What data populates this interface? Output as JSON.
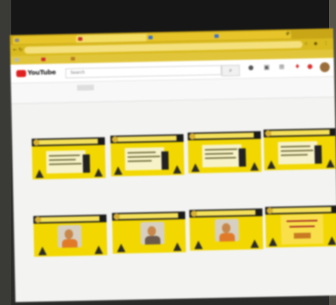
{
  "browser": {
    "tabs": [
      {
        "label": "",
        "active": false
      },
      {
        "label": "",
        "active": true
      },
      {
        "label": "",
        "active": false
      },
      {
        "label": "",
        "active": false
      }
    ],
    "url": "",
    "bookmarks": [
      {
        "label": "",
        "color": "#b8b8b8"
      },
      {
        "label": "",
        "color": "#d12b2b"
      },
      {
        "label": "",
        "color": "#b87a1f"
      }
    ]
  },
  "youtube": {
    "logo_text": "YouTube",
    "search_placeholder": "Search",
    "channel_tabs": [
      {
        "label": "",
        "active": false
      },
      {
        "label": "",
        "active": true
      },
      {
        "label": "",
        "active": false
      },
      {
        "label": "",
        "active": false
      },
      {
        "label": "",
        "active": false
      },
      {
        "label": "",
        "active": false
      }
    ]
  },
  "colors": {
    "accent_yellow": "#f2d800",
    "youtube_red": "#e02020"
  },
  "videos_row1": [
    {
      "title": "",
      "meta": "",
      "duration": ""
    },
    {
      "title": "",
      "meta": "",
      "duration": ""
    },
    {
      "title": "",
      "meta": "",
      "duration": ""
    },
    {
      "title": "",
      "meta": "",
      "duration": ""
    }
  ],
  "videos_row2": [
    {
      "title": "",
      "meta": "",
      "duration": ""
    },
    {
      "title": "",
      "meta": "",
      "duration": ""
    },
    {
      "title": "",
      "meta": "",
      "duration": ""
    },
    {
      "title": "",
      "meta": "",
      "duration": ""
    }
  ],
  "top_partial_meta": [
    "",
    "",
    "",
    ""
  ]
}
